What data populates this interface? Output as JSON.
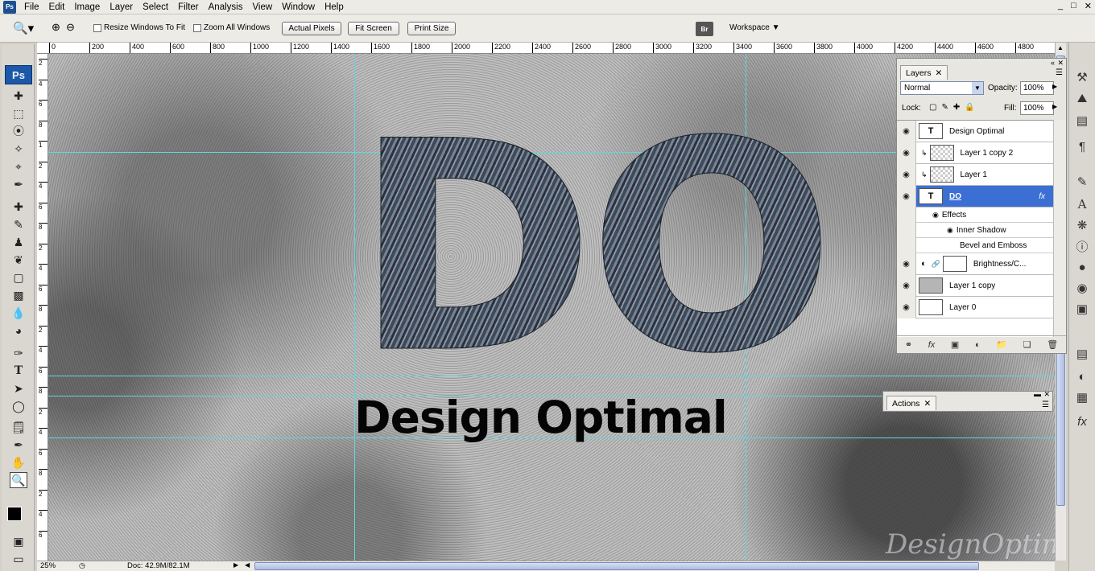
{
  "menubar": {
    "app_badge": "Ps",
    "items": [
      "File",
      "Edit",
      "Image",
      "Layer",
      "Select",
      "Filter",
      "Analysis",
      "View",
      "Window",
      "Help"
    ],
    "window_controls": [
      "_",
      "□",
      "✕"
    ]
  },
  "options_bar": {
    "tool_icon": "zoom-icon",
    "resize_windows_label": "Resize Windows To Fit",
    "zoom_all_label": "Zoom All Windows",
    "actual_pixels": "Actual Pixels",
    "fit_screen": "Fit Screen",
    "print_size": "Print Size",
    "bridge_badge": "Br",
    "workspace_label": "Workspace"
  },
  "toolbox": {
    "logo": "Ps"
  },
  "ruler": {
    "h_labels": [
      "0",
      "200",
      "400",
      "600",
      "800",
      "1000",
      "1200",
      "1400",
      "1600",
      "1800",
      "2000",
      "2200",
      "2400",
      "2600",
      "2800",
      "3000",
      "3200",
      "3400",
      "3600",
      "3800",
      "4000",
      "4200",
      "4400",
      "4600",
      "4800"
    ],
    "v_labels": [
      "2",
      "4",
      "6",
      "8",
      "1",
      "2",
      "4",
      "6",
      "8",
      "2",
      "4",
      "6",
      "8",
      "2",
      "4",
      "6",
      "8",
      "2",
      "4",
      "6",
      "8",
      "2",
      "4",
      "6"
    ]
  },
  "canvas": {
    "headline": "DO",
    "subline": "Design Optimal",
    "watermark": "DesignOptimal.com"
  },
  "status": {
    "zoom": "25%",
    "doc": "Doc: 42.9M/82.1M"
  },
  "layers_panel": {
    "tab_label": "Layers",
    "blend_mode": "Normal",
    "opacity_label": "Opacity:",
    "opacity_value": "100%",
    "lock_label": "Lock:",
    "fill_label": "Fill:",
    "fill_value": "100%",
    "layers": [
      {
        "name": "Design Optimal",
        "thumb": "T"
      },
      {
        "name": "Layer 1 copy 2",
        "thumb": ""
      },
      {
        "name": "Layer 1",
        "thumb": ""
      },
      {
        "name": "DO",
        "thumb": "T",
        "fx": "fx"
      },
      {
        "name": "Brightness/C...",
        "thumb": ""
      },
      {
        "name": "Layer 1 copy",
        "thumb": ""
      },
      {
        "name": "Layer 0",
        "thumb": ""
      }
    ],
    "effects_label": "Effects",
    "effects": [
      "Inner Shadow",
      "Bevel and Emboss"
    ]
  },
  "actions_panel": {
    "tab_label": "Actions"
  }
}
